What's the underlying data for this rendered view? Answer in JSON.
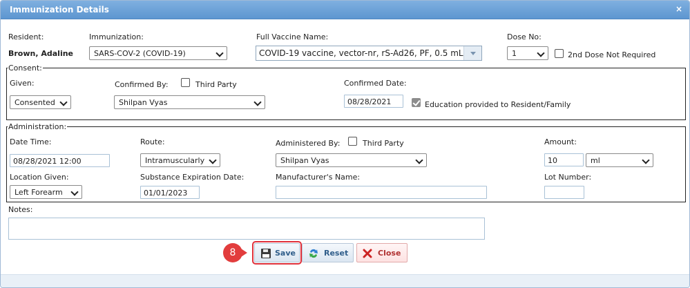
{
  "dialog": {
    "title": "Immunization Details",
    "close_glyph": "×"
  },
  "resident": {
    "label": "Resident:",
    "value": "Brown, Adaline"
  },
  "immunization": {
    "label": "Immunization:",
    "value": "SARS-COV-2 (COVID-19)"
  },
  "full_vaccine": {
    "label": "Full Vaccine Name:",
    "value": "COVID-19 vaccine, vector-nr, rS-Ad26, PF, 0.5 mL"
  },
  "dose": {
    "label": "Dose No:",
    "value": "1",
    "second_dose_label": "2nd Dose Not Required",
    "second_dose_checked": false
  },
  "consent": {
    "legend": "Consent:",
    "given_label": "Given:",
    "given_value": "Consented",
    "confirmed_by_label": "Confirmed By:",
    "third_party_label": "Third Party",
    "third_party_checked": false,
    "confirmed_by_value": "Shilpan Vyas",
    "confirmed_date_label": "Confirmed Date:",
    "confirmed_date_value": "08/28/2021",
    "education_label": "Education provided to Resident/Family",
    "education_checked": true
  },
  "administration": {
    "legend": "Administration:",
    "date_time_label": "Date Time:",
    "date_time_value": "08/28/2021 12:00",
    "route_label": "Route:",
    "route_value": "Intramuscularly",
    "administered_by_label": "Administered By:",
    "third_party_label": "Third Party",
    "third_party_checked": false,
    "administered_by_value": "Shilpan Vyas",
    "amount_label": "Amount:",
    "amount_value": "10",
    "unit_value": "ml",
    "location_label": "Location Given:",
    "location_value": "Left Forearm",
    "expiration_label": "Substance Expiration Date:",
    "expiration_value": "01/01/2023",
    "manufacturer_label": "Manufacturer's Name:",
    "manufacturer_value": "",
    "lot_label": "Lot Number:",
    "lot_value": ""
  },
  "notes": {
    "label": "Notes:",
    "value": ""
  },
  "actions": {
    "step_number": "8",
    "save_label": "Save",
    "reset_label": "Reset",
    "close_label": "Close"
  },
  "colors": {
    "title_bar": "#5d96d0",
    "highlight": "#e0303a",
    "callout": "#e23d3d"
  }
}
